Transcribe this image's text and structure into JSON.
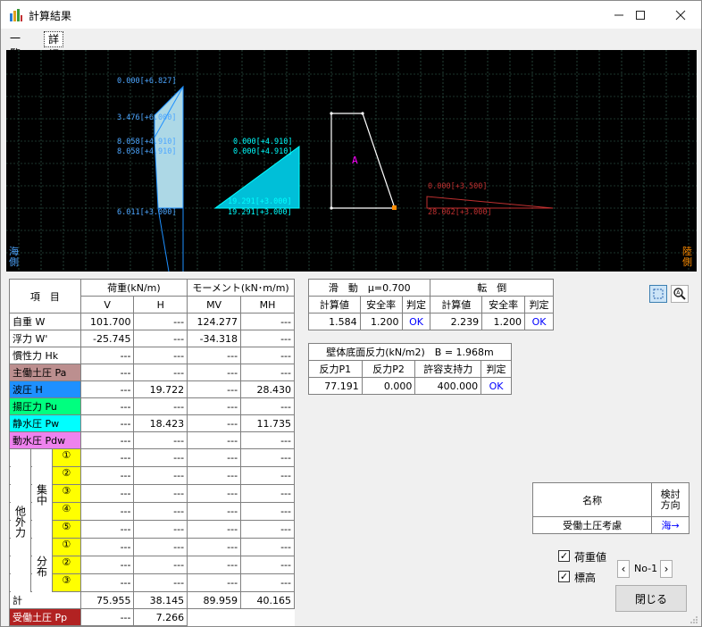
{
  "window": {
    "title": "計算結果"
  },
  "tabs": [
    {
      "label": "一覧"
    },
    {
      "label": "詳細"
    }
  ],
  "canvas": {
    "side_left": "海側",
    "side_right": "陸側",
    "labels": {
      "a1": "0.000[+6.827]",
      "a2": "3.476[+6.000]",
      "a3": "8.058[+4.910]",
      "a4": "8.058[+4.910]",
      "a5": "6.011[+3.000]",
      "b1": "0.000[+4.910]",
      "b2": "0.000[+4.910]",
      "b3": "19.291[+3.000]",
      "b4": "19.291[+3.000]",
      "block": "A",
      "c1": "0.000[+3.500]",
      "c2": "28.062[+3.000]"
    }
  },
  "load_table": {
    "h_item": "項　目",
    "h_load": "荷重(kN/m)",
    "h_moment": "モーメント(kN･m/m)",
    "h_v": "V",
    "h_h": "H",
    "h_mv": "MV",
    "h_mh": "MH",
    "rows": [
      {
        "label": "自重 W",
        "color": "",
        "v": "101.700",
        "h": "---",
        "mv": "124.277",
        "mh": "---"
      },
      {
        "label": "浮力 W'",
        "color": "",
        "v": "-25.745",
        "h": "---",
        "mv": "-34.318",
        "mh": "---"
      },
      {
        "label": "慣性力 Hk",
        "color": "",
        "v": "---",
        "h": "---",
        "mv": "---",
        "mh": "---"
      },
      {
        "label": "主働土圧 Pa",
        "color": "#bc8f8f",
        "v": "---",
        "h": "---",
        "mv": "---",
        "mh": "---"
      },
      {
        "label": "波圧 H",
        "color": "#1e90ff",
        "v": "---",
        "h": "19.722",
        "mv": "---",
        "mh": "28.430"
      },
      {
        "label": "揚圧力 Pu",
        "color": "#00ff7f",
        "v": "---",
        "h": "---",
        "mv": "---",
        "mh": "---"
      },
      {
        "label": "静水圧 Pw",
        "color": "#00ffff",
        "v": "---",
        "h": "18.423",
        "mv": "---",
        "mh": "11.735"
      },
      {
        "label": "動水圧 Pdw",
        "color": "#ee82ee",
        "v": "---",
        "h": "---",
        "mv": "---",
        "mh": "---"
      }
    ],
    "other_label": "他外力",
    "conc_label": "集中",
    "dist_label": "分布",
    "conc_rows": [
      {
        "no": "①",
        "v": "---",
        "h": "---",
        "mv": "---",
        "mh": "---"
      },
      {
        "no": "②",
        "v": "---",
        "h": "---",
        "mv": "---",
        "mh": "---"
      },
      {
        "no": "③",
        "v": "---",
        "h": "---",
        "mv": "---",
        "mh": "---"
      },
      {
        "no": "④",
        "v": "---",
        "h": "---",
        "mv": "---",
        "mh": "---"
      },
      {
        "no": "⑤",
        "v": "---",
        "h": "---",
        "mv": "---",
        "mh": "---"
      }
    ],
    "dist_rows": [
      {
        "no": "①",
        "v": "---",
        "h": "---",
        "mv": "---",
        "mh": "---"
      },
      {
        "no": "②",
        "v": "---",
        "h": "---",
        "mv": "---",
        "mh": "---"
      },
      {
        "no": "③",
        "v": "---",
        "h": "---",
        "mv": "---",
        "mh": "---"
      }
    ],
    "total": {
      "label": "計",
      "v": "75.955",
      "h": "38.145",
      "mv": "89.959",
      "mh": "40.165"
    },
    "passive": {
      "label": "受働土圧 Pp",
      "color": "#b22222",
      "v": "---",
      "h": "7.266",
      "mv": "",
      "mh": ""
    }
  },
  "stability": {
    "sliding": "滑　動　μ=0.700",
    "overturn": "転　倒",
    "h_calc": "計算値",
    "h_sf": "安全率",
    "h_judge": "判定",
    "slide_calc": "1.584",
    "slide_sf": "1.200",
    "slide_judge": "OK",
    "over_calc": "2.239",
    "over_sf": "1.200",
    "over_judge": "OK"
  },
  "reaction": {
    "title": "壁体底面反力(kN/m2)　B = 1.968m",
    "h_p1": "反力P1",
    "h_p2": "反力P2",
    "h_allow": "許容支持力",
    "h_judge": "判定",
    "p1": "77.191",
    "p2": "0.000",
    "allow": "400.000",
    "judge": "OK"
  },
  "name_table": {
    "h_name": "名称",
    "h_dir": "検討方向",
    "name": "受働土圧考慮",
    "dir": "海→"
  },
  "options": {
    "load_value": {
      "label": "荷重値",
      "checked": true
    },
    "elevation": {
      "label": "標高",
      "checked": true
    }
  },
  "pager": {
    "label": "No-1"
  },
  "close_label": "閉じる"
}
